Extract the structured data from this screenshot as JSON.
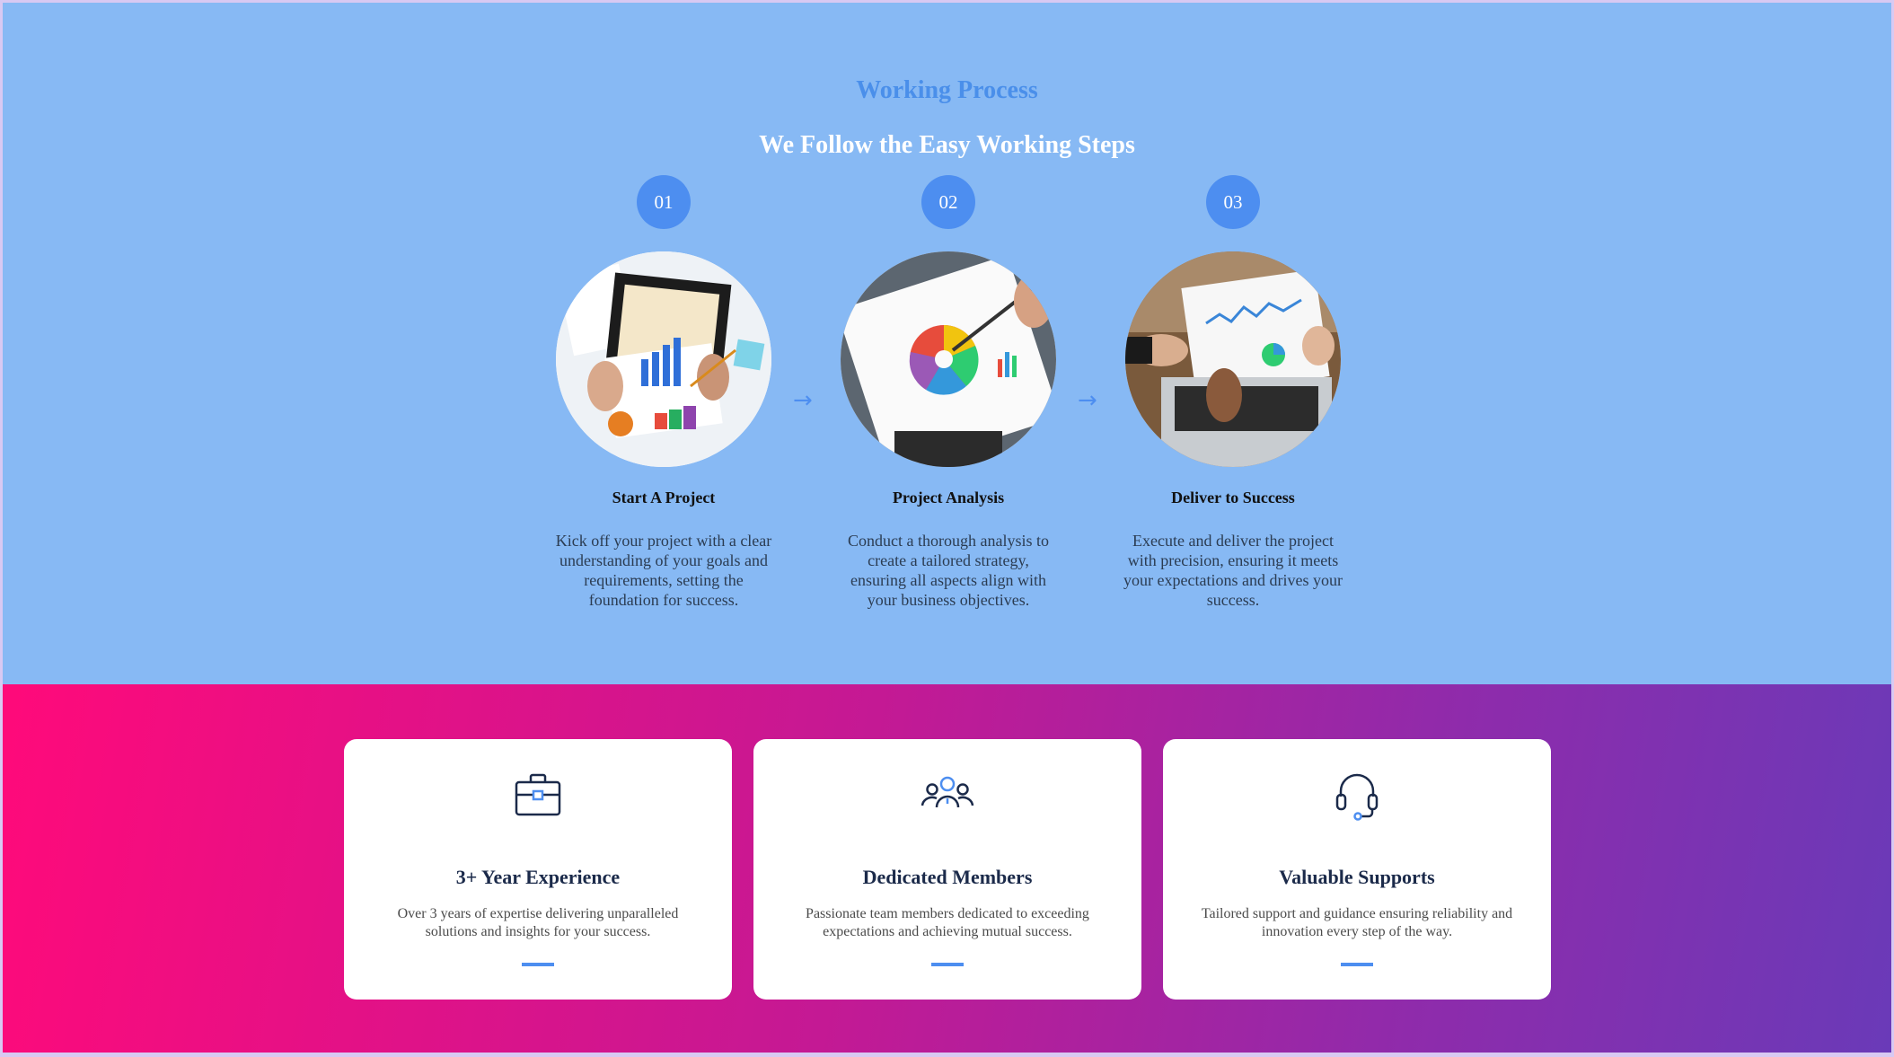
{
  "process": {
    "eyebrow": "Working Process",
    "headline": "We Follow the Easy Working Steps",
    "arrow_glyph": "→",
    "steps": [
      {
        "number": "01",
        "title": "Start A Project",
        "description": "Kick off your project with a clear understanding of your goals and requirements, setting the foundation for success.",
        "image": "charts-and-tablet-on-desk-photo"
      },
      {
        "number": "02",
        "title": "Project Analysis",
        "description": "Conduct a thorough analysis to create a tailored strategy, ensuring all aspects align with your business objectives.",
        "image": "pie-chart-report-photo"
      },
      {
        "number": "03",
        "title": "Deliver to Success",
        "description": "Execute and deliver the project with precision, ensuring it meets your expectations and drives your success.",
        "image": "laptop-with-report-photo"
      }
    ]
  },
  "features": {
    "cards": [
      {
        "icon": "briefcase-icon",
        "title": "3+ Year Experience",
        "description": "Over 3 years of expertise delivering unparalleled solutions and insights for your success."
      },
      {
        "icon": "team-icon",
        "title": "Dedicated Members",
        "description": "Passionate team members dedicated to exceeding expectations and achieving mutual success."
      },
      {
        "icon": "headset-icon",
        "title": "Valuable Supports",
        "description": "Tailored support and guidance ensuring reliability and innovation every step of the way."
      }
    ]
  },
  "colors": {
    "process_background": "#87b9f4",
    "accent_blue": "#4d8ef0",
    "gradient_start": "#ff0a7a",
    "gradient_end": "#6a3ab8",
    "card_title": "#1b2a4a"
  }
}
